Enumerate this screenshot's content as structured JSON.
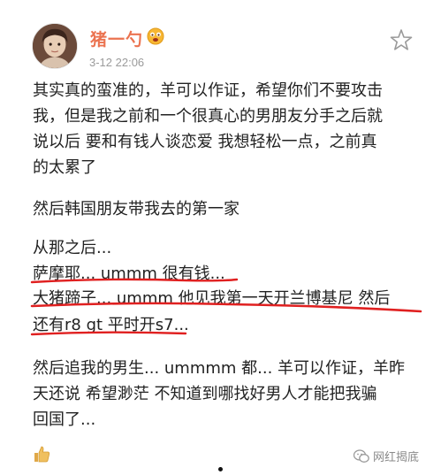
{
  "header": {
    "username": "猪一勺",
    "timestamp": "3-12 22:06"
  },
  "post": {
    "lines": [
      "其实真的蛮准的，羊可以作证，希望你们不要攻击",
      "我，但是我之前和一个很真心的男朋友分手之后就",
      "说以后 要和有钱人谈恋爱 我想轻松一点，之前真",
      "的太累了",
      "然后韩国朋友带我去的第一家",
      "从那之后...",
      "萨摩耶... ummm 很有钱...",
      "大猪蹄子... ummm 他见我第一天开兰博基尼 然后",
      "还有r8 gt 平时开s7...",
      "然后追我的男生... ummmm 都... 羊可以作证，羊昨",
      "天还说 希望渺茫 不知道到哪找好男人才能把我骗",
      "回国了..."
    ]
  },
  "footer": {
    "watermark": "网红揭底"
  },
  "colors": {
    "username": "#eb7350",
    "marker": "#e02020",
    "timestamp": "#9b9b9b"
  },
  "icons": {
    "verified_badge": "emoji-face-icon",
    "favorite": "star-icon",
    "like": "like-icon",
    "watermark": "wechat-icon"
  }
}
